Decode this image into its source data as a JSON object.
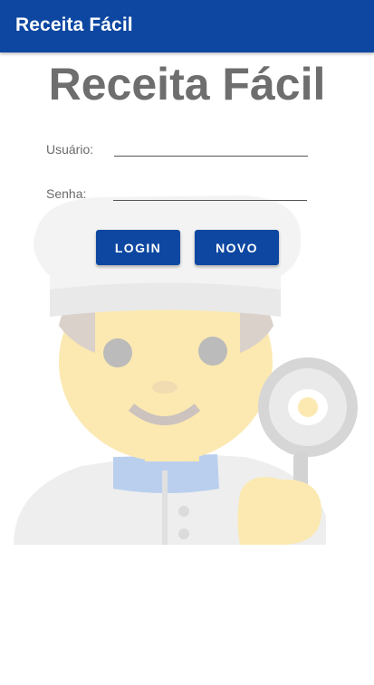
{
  "appbar": {
    "title": "Receita Fácil"
  },
  "main": {
    "title": "Receita Fácil",
    "form": {
      "username_label": "Usuário:",
      "username_value": "",
      "password_label": "Senha:",
      "password_value": ""
    },
    "buttons": {
      "login": "LOGIN",
      "new": "NOVO"
    }
  },
  "colors": {
    "primary": "#0d47a1",
    "title_text": "#6e6e6e"
  },
  "icons": {
    "background": "chef-illustration-icon"
  }
}
